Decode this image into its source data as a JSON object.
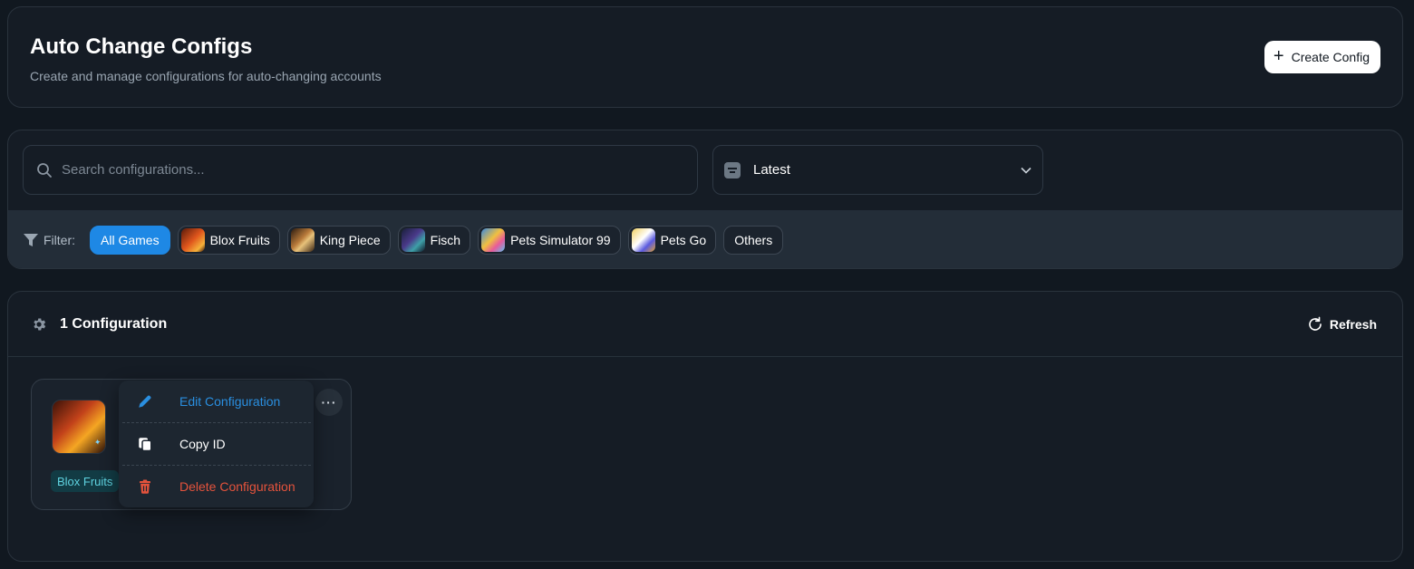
{
  "header": {
    "title": "Auto Change Configs",
    "subtitle": "Create and manage configurations for auto-changing accounts",
    "create_button": "Create Config"
  },
  "search": {
    "placeholder": "Search configurations...",
    "value": ""
  },
  "sort": {
    "selected": "Latest"
  },
  "filter": {
    "label": "Filter:",
    "chips": [
      {
        "label": "All Games",
        "active": true
      },
      {
        "label": "Blox Fruits",
        "active": false
      },
      {
        "label": "King Piece",
        "active": false
      },
      {
        "label": "Fisch",
        "active": false
      },
      {
        "label": "Pets Simulator 99",
        "active": false
      },
      {
        "label": "Pets Go",
        "active": false
      },
      {
        "label": "Others",
        "active": false
      }
    ]
  },
  "list": {
    "count_label": "1 Configuration",
    "refresh_label": "Refresh"
  },
  "config": {
    "game_badge": "Blox Fruits"
  },
  "context_menu": {
    "edit": "Edit Configuration",
    "copy": "Copy ID",
    "delete": "Delete Configuration"
  },
  "colors": {
    "accent": "#1e88e5",
    "danger": "#e5533c",
    "badge_text": "#5fd3e0",
    "background": "#111820"
  }
}
